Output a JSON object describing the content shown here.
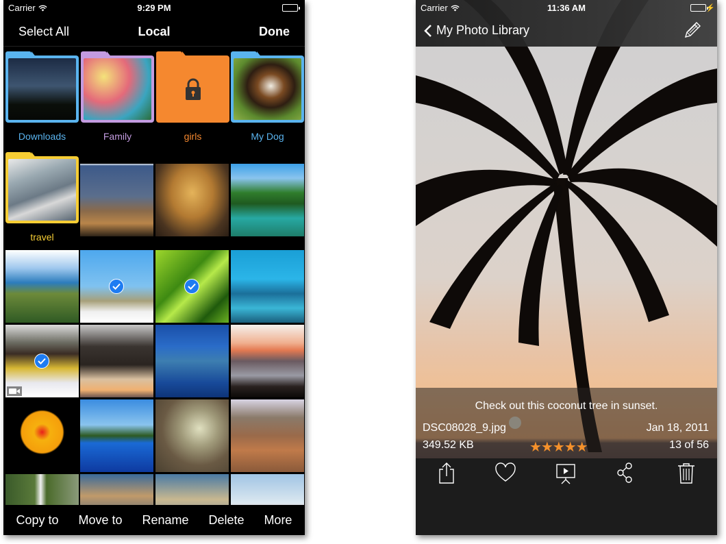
{
  "left_screen": {
    "status": {
      "carrier": "Carrier",
      "time": "9:29 PM"
    },
    "navbar": {
      "select_all": "Select All",
      "title": "Local",
      "done": "Done"
    },
    "folders": [
      {
        "name": "Downloads",
        "color": "#5ab4ef",
        "locked": false
      },
      {
        "name": "Family",
        "color": "#c39be0",
        "locked": false
      },
      {
        "name": "girls",
        "color": "#f5882f",
        "locked": true
      },
      {
        "name": "My Dog",
        "color": "#5ab4ef",
        "locked": false
      },
      {
        "name": "travel",
        "color": "#f6cd34",
        "locked": false
      }
    ],
    "photos": [
      {
        "subject": "eiffel-tower",
        "selected": false
      },
      {
        "subject": "arc-de-triomphe",
        "selected": false
      },
      {
        "subject": "waterfall-lagoon",
        "selected": false
      },
      {
        "subject": "coastal-mountains",
        "selected": false
      },
      {
        "subject": "jumping-beach",
        "selected": true
      },
      {
        "subject": "lizard-fern",
        "selected": true
      },
      {
        "subject": "manta-ray",
        "selected": false
      },
      {
        "subject": "bus-video",
        "selected": true,
        "video": true
      },
      {
        "subject": "palm-sunset",
        "selected": false
      },
      {
        "subject": "whales",
        "selected": false
      },
      {
        "subject": "sunset-clouds",
        "selected": false
      },
      {
        "subject": "hibiscus",
        "selected": false
      },
      {
        "subject": "palm-reflection",
        "selected": false
      },
      {
        "subject": "tropical-fish",
        "selected": false
      },
      {
        "subject": "crater",
        "selected": false
      },
      {
        "subject": "waterfall-cliff",
        "selected": false
      },
      {
        "subject": "mountain-clouds",
        "selected": false
      },
      {
        "subject": "shore-clouds",
        "selected": false
      },
      {
        "subject": "group-photo",
        "selected": false
      }
    ],
    "toolbar": {
      "copy_to": "Copy to",
      "move_to": "Move to",
      "rename": "Rename",
      "delete": "Delete",
      "more": "More"
    },
    "check_color": "#1e7cf2"
  },
  "right_screen": {
    "status": {
      "carrier": "Carrier",
      "time": "11:36 AM",
      "battery_color": "#4cd964"
    },
    "navbar": {
      "back_label": "My Photo Library",
      "edit_icon": "pencil-icon"
    },
    "photo": {
      "caption": "Check out this coconut tree in sunset.",
      "filename": "DSC08028_9.jpg",
      "date": "Jan 18, 2011",
      "size": "349.52 KB",
      "rating": 5,
      "rating_max": 5,
      "stars": "★★★★★",
      "position": "13 of 56",
      "star_color": "#f5912b"
    },
    "toolbar": [
      "share-icon",
      "heart-icon",
      "slideshow-icon",
      "share-nodes-icon",
      "trash-icon"
    ]
  }
}
